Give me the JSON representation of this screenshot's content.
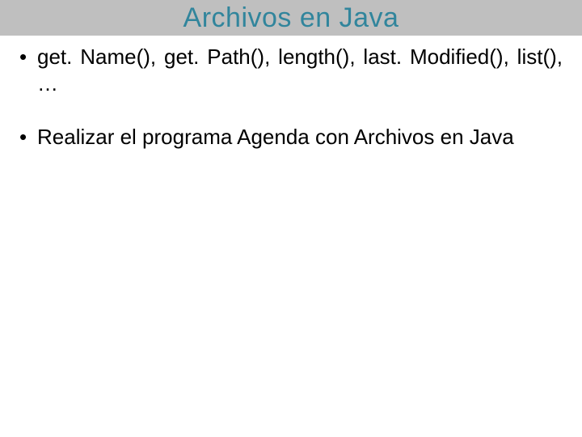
{
  "title": "Archivos en Java",
  "bullets": [
    "get. Name(), get. Path(), length(), last. Modified(), list(), …",
    "Realizar el programa Agenda con Archivos en Java"
  ]
}
